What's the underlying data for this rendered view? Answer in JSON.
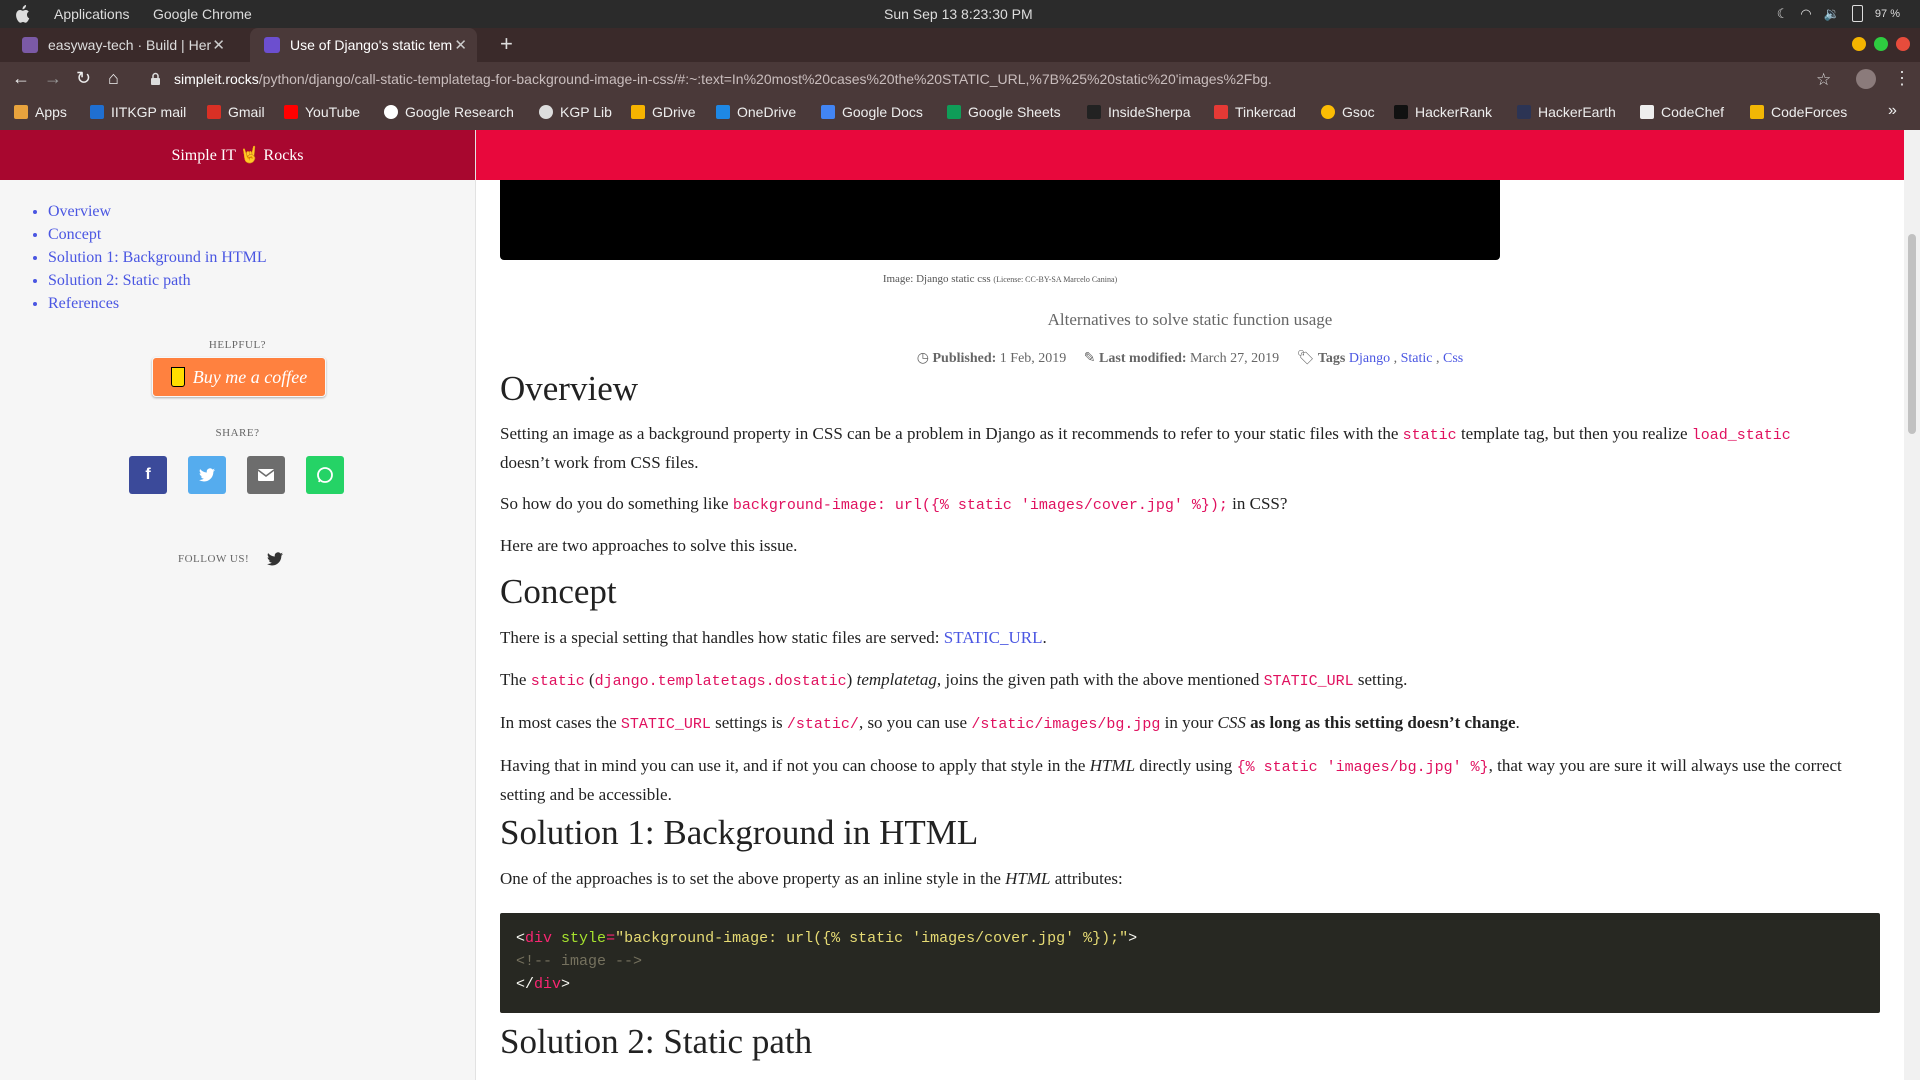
{
  "os": {
    "applications": "Applications",
    "active_app": "Google Chrome",
    "clock": "Sun Sep 13   8:23:30 PM",
    "battery": "97 %"
  },
  "tabs": [
    {
      "title": "easyway-tech · Build | Her",
      "fav_color": "#7b5aa6"
    },
    {
      "title": "Use of Django's static tem",
      "fav_color": "#6c4fcf"
    }
  ],
  "address": {
    "domain": "simpleit.rocks",
    "path": "/python/django/call-static-templatetag-for-background-image-in-css/#:~:text=In%20most%20cases%20the%20STATIC_URL,%7B%25%20static%20'images%2Fbg."
  },
  "bookmarks": [
    {
      "label": "Apps",
      "color": "#e8a33d"
    },
    {
      "label": "IITKGP mail",
      "color": "#1f6fd1"
    },
    {
      "label": "Gmail",
      "color": "#d93025"
    },
    {
      "label": "YouTube",
      "color": "#ff0000"
    },
    {
      "label": "Google Research",
      "color": "#ffffff"
    },
    {
      "label": "KGP Lib",
      "color": "#dddddd"
    },
    {
      "label": "GDrive",
      "color": "#f6b400"
    },
    {
      "label": "OneDrive",
      "color": "#1e88e5"
    },
    {
      "label": "Google Docs",
      "color": "#4285f4"
    },
    {
      "label": "Google Sheets",
      "color": "#0f9d58"
    },
    {
      "label": "InsideSherpa",
      "color": "#222222"
    },
    {
      "label": "Tinkercad",
      "color": "#e53935"
    },
    {
      "label": "Gsoc",
      "color": "#fbbc04"
    },
    {
      "label": "HackerRank",
      "color": "#111111"
    },
    {
      "label": "HackerEarth",
      "color": "#2c3454"
    },
    {
      "label": "CodeChef",
      "color": "#eeeeee"
    },
    {
      "label": "CodeForces",
      "color": "#f2b705"
    }
  ],
  "site": {
    "brand": "Simple IT 🤘 Rocks",
    "toc": [
      "Overview",
      "Concept",
      "Solution 1: Background in HTML",
      "Solution 2: Static path",
      "References"
    ],
    "helpful": "HELPFUL?",
    "coffee": "Buy me a coffee",
    "share": "SHARE?",
    "follow": "FOLLOW US!"
  },
  "article": {
    "caption": "Image: Django static css",
    "caption_license": "(License: CC-BY-SA Marcelo Canina)",
    "subtitle": "Alternatives to solve static function usage",
    "published_label": "Published:",
    "published": "1 Feb, 2019",
    "modified_label": "Last modified:",
    "modified": "March 27, 2019",
    "tags_label": "Tags",
    "tags": [
      "Django",
      "Static",
      "Css"
    ],
    "h_overview": "Overview",
    "p1a": "Setting an image as a background property in CSS can be a problem in Django as it recommends to refer to your static files with the ",
    "p1_code1": "static",
    "p1b": " template tag, but then you realize ",
    "p1_code2": "load_static",
    "p1c": "doesn’t work from CSS files.",
    "p2a": "So how do you do something like ",
    "p2_code": "background-image: url({% static 'images/cover.jpg' %});",
    "p2b": " in CSS?",
    "p3": "Here are two approaches to solve this issue.",
    "h_concept": "Concept",
    "p4a": "There is a special setting that handles how static files are served: ",
    "p4_link": "STATIC_URL",
    "p4b": ".",
    "p5a": "The ",
    "p5_code1": "static",
    "p5b": " (",
    "p5_code2": "django.templatetags.dostatic",
    "p5c": ") ",
    "p5_em": "templatetag",
    "p5d": ", joins the given path with the above mentioned ",
    "p5_code3": "STATIC_URL",
    "p5e": " setting.",
    "p6a": "In most cases the ",
    "p6_code1": "STATIC_URL",
    "p6b": " settings is ",
    "p6_code2": "/static/",
    "p6c": ", so you can use ",
    "p6_code3": "/static/images/bg.jpg",
    "p6d": " in your ",
    "p6_em": "CSS",
    "p6_strong": " as long as this setting doesn’t change",
    "p6e": ".",
    "p7a": "Having that in mind you can use it, and if not you can choose to apply that style in the ",
    "p7_em": "HTML",
    "p7b": " directly using ",
    "p7_code": "{% static 'images/bg.jpg' %}",
    "p7c": ", that way you are sure it will always use the correct setting and be accessible.",
    "h_sol1": "Solution 1: Background in HTML",
    "p8a": "One of the approaches is to set the above property as an inline style in the ",
    "p8_em": "HTML",
    "p8b": " attributes:",
    "code_line1_tag": "div",
    "code_line1_attr": "style",
    "code_line1_str": "\"background-image: url({% static 'images/cover.jpg' %});\"",
    "code_line2": "<!-- image -->",
    "code_line3_tag": "div",
    "h_sol2": "Solution 2: Static path"
  }
}
